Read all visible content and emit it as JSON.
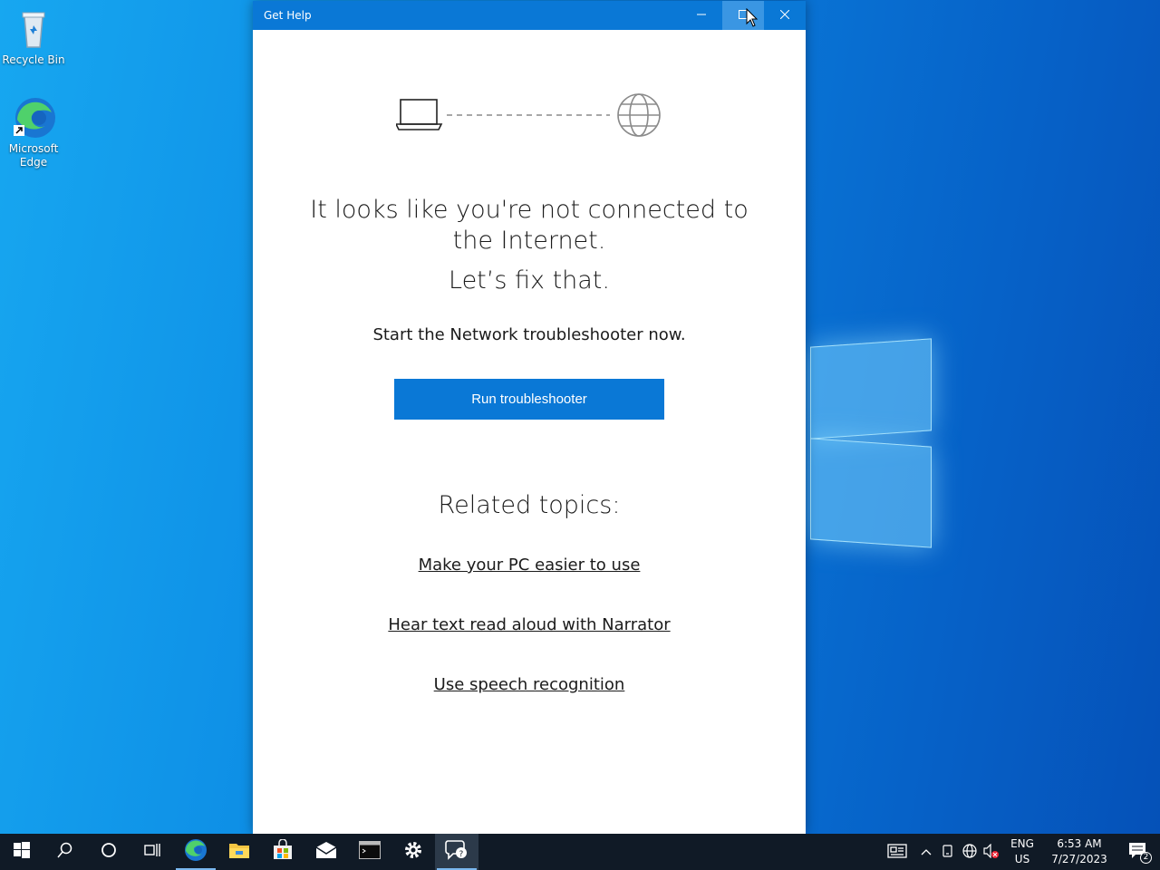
{
  "desktop": {
    "icons": [
      {
        "label": "Recycle Bin"
      },
      {
        "label": "Microsoft Edge"
      }
    ]
  },
  "window": {
    "title": "Get Help",
    "headline": "It looks like you're not connected to the Internet.",
    "fix": "Let’s fix that.",
    "subtitle": "Start the Network troubleshooter now.",
    "run_button": "Run troubleshooter",
    "related_heading": "Related topics:",
    "links": [
      "Make your PC easier to use",
      "Hear text read aloud with Narrator",
      "Use speech recognition"
    ]
  },
  "taskbar": {
    "apps": [
      "start-icon",
      "search-icon",
      "cortana-icon",
      "task-view-icon",
      "edge-icon",
      "file-explorer-icon",
      "store-icon",
      "mail-icon",
      "terminal-icon",
      "settings-icon",
      "get-help-icon"
    ],
    "tray": {
      "lang_top": "ENG",
      "lang_bottom": "US",
      "time": "6:53 AM",
      "date": "7/27/2023",
      "notification_count": "2"
    }
  },
  "colors": {
    "accent": "#0a78d6",
    "taskbar": "#101a26"
  }
}
